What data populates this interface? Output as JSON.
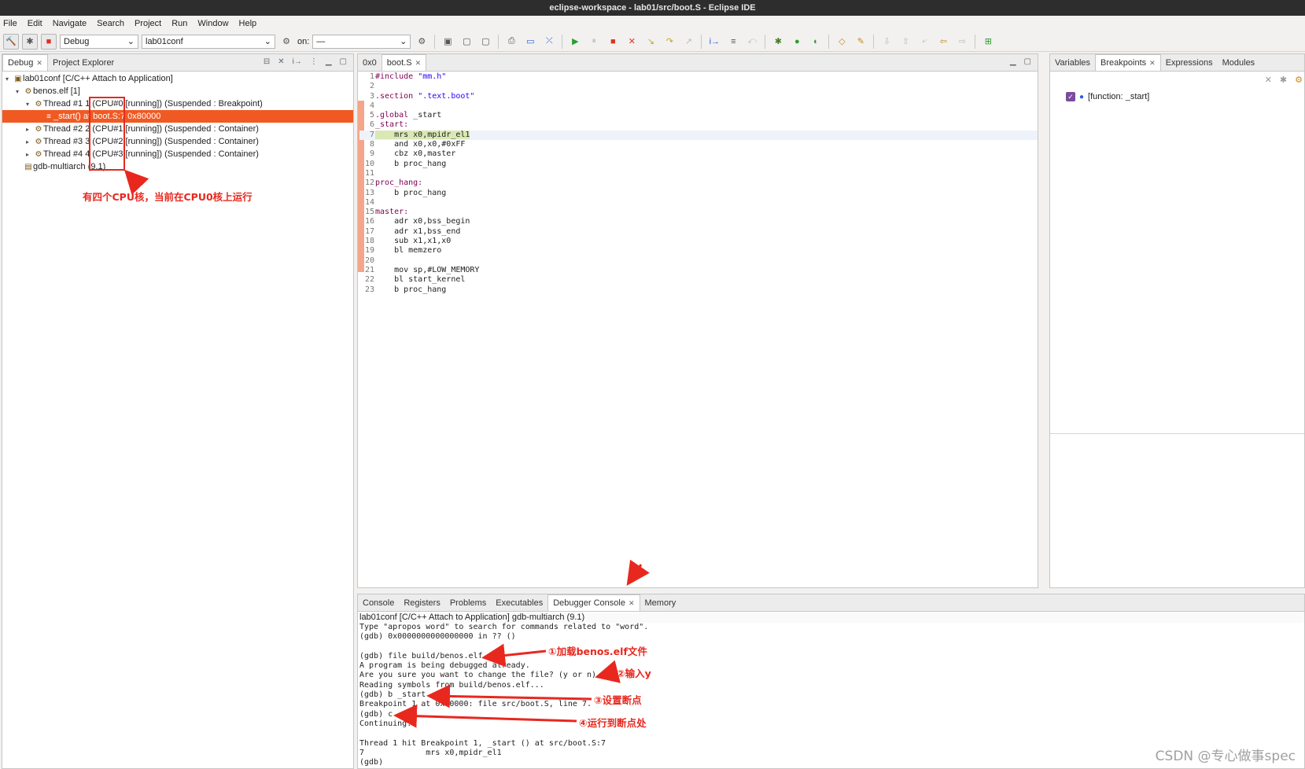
{
  "window": {
    "title": "eclipse-workspace - lab01/src/boot.S - Eclipse IDE"
  },
  "menu": [
    "File",
    "Edit",
    "Navigate",
    "Search",
    "Project",
    "Run",
    "Window",
    "Help"
  ],
  "toolbar": {
    "launch_mode": "Debug",
    "launch_config": "lab01conf",
    "target_label": "on:",
    "target_value": "—"
  },
  "debug_view": {
    "tabs": [
      {
        "label": "Debug",
        "active": true,
        "icon": "bug-icon"
      },
      {
        "label": "Project Explorer",
        "active": false,
        "icon": "folder-icon"
      }
    ],
    "tree": [
      {
        "level": 0,
        "twisty": "▾",
        "icon": "c-launch-icon",
        "label": "lab01conf [C/C++ Attach to Application]"
      },
      {
        "level": 1,
        "twisty": "▾",
        "icon": "process-icon",
        "label": "benos.elf [1]"
      },
      {
        "level": 2,
        "twisty": "▾",
        "icon": "thread-icon",
        "label": "Thread #1 1 (CPU#0 [running]) (Suspended : Breakpoint)"
      },
      {
        "level": 3,
        "twisty": "",
        "icon": "stack-frame-icon",
        "label": "_start() at boot.S:7 0x80000",
        "selected": true
      },
      {
        "level": 2,
        "twisty": "▸",
        "icon": "thread-icon",
        "label": "Thread #2 2 (CPU#1 [running]) (Suspended : Container)"
      },
      {
        "level": 2,
        "twisty": "▸",
        "icon": "thread-icon",
        "label": "Thread #3 3 (CPU#2 [running]) (Suspended : Container)"
      },
      {
        "level": 2,
        "twisty": "▸",
        "icon": "thread-icon",
        "label": "Thread #4 4 (CPU#3 [running]) (Suspended : Container)"
      },
      {
        "level": 1,
        "twisty": "",
        "icon": "gdb-icon",
        "label": "gdb-multiarch (9.1)"
      }
    ],
    "annotation": "有四个CPU核，当前在CPU0核上运行"
  },
  "editor": {
    "tabs": [
      {
        "label": "0x0",
        "active": false
      },
      {
        "label": "boot.S",
        "active": true
      }
    ],
    "lines": [
      {
        "n": "1",
        "html": "<span class='kw'>#include</span> <span class='str'>\"mm.h\"</span>"
      },
      {
        "n": "2",
        "html": ""
      },
      {
        "n": "3",
        "html": "<span class='kw'>.section</span> <span class='str'>\".text.boot\"</span>"
      },
      {
        "n": "4",
        "html": ""
      },
      {
        "n": "5",
        "html": "<span class='kw'>.global</span> _start"
      },
      {
        "n": "6",
        "html": "<span class='lab'>_start:</span>"
      },
      {
        "n": "7",
        "html": "    mrs x0,mpidr_el1",
        "current": true
      },
      {
        "n": "8",
        "html": "    and x0,x0,#0xFF"
      },
      {
        "n": "9",
        "html": "    cbz x0,master"
      },
      {
        "n": "10",
        "html": "    b proc_hang"
      },
      {
        "n": "11",
        "html": ""
      },
      {
        "n": "12",
        "html": "<span class='lab'>proc_hang:</span>"
      },
      {
        "n": "13",
        "html": "    b proc_hang"
      },
      {
        "n": "14",
        "html": ""
      },
      {
        "n": "15",
        "html": "<span class='lab'>master:</span>"
      },
      {
        "n": "16",
        "html": "    adr x0,bss_begin"
      },
      {
        "n": "17",
        "html": "    adr x1,bss_end"
      },
      {
        "n": "18",
        "html": "    sub x1,x1,x0"
      },
      {
        "n": "19",
        "html": "    bl memzero"
      },
      {
        "n": "20",
        "html": ""
      },
      {
        "n": "21",
        "html": "    mov sp,#LOW_MEMORY"
      },
      {
        "n": "22",
        "html": "    bl start_kernel"
      },
      {
        "n": "23",
        "html": "    b proc_hang"
      }
    ]
  },
  "right_view": {
    "tabs": [
      {
        "label": "Variables",
        "active": false
      },
      {
        "label": "Breakpoints",
        "active": true
      },
      {
        "label": "Expressions",
        "active": false
      },
      {
        "label": "Modules",
        "active": false
      }
    ],
    "breakpoint": {
      "label": "[function: _start]",
      "checked": true
    }
  },
  "console_view": {
    "tabs": [
      {
        "label": "Console",
        "active": false
      },
      {
        "label": "Registers",
        "active": false
      },
      {
        "label": "Problems",
        "active": false
      },
      {
        "label": "Executables",
        "active": false
      },
      {
        "label": "Debugger Console",
        "active": true
      },
      {
        "label": "Memory",
        "active": false
      }
    ],
    "header": "lab01conf [C/C++ Attach to Application] gdb-multiarch (9.1)",
    "lines": [
      "Type \"apropos word\" to search for commands related to \"word\".",
      "(gdb) 0x0000000000000000 in ?? ()",
      "",
      "(gdb) file build/benos.elf",
      "A program is being debugged already.",
      "Are you sure you want to change the file? (y or n) y",
      "Reading symbols from build/benos.elf...",
      "(gdb) b _start",
      "Breakpoint 1 at 0x80000: file src/boot.S, line 7.",
      "(gdb) c",
      "Continuing.",
      "",
      "Thread 1 hit Breakpoint 1, _start () at src/boot.S:7",
      "7             mrs x0,mpidr_el1",
      "(gdb)"
    ],
    "annotations": [
      "①加载benos.elf文件",
      "②输入y",
      "③设置断点",
      "④运行到断点处"
    ]
  },
  "watermark": "CSDN @专心做事spec",
  "colors": {
    "selection": "#f05a22",
    "annotation": "#e8281f",
    "current_line": "#d9e8b4"
  }
}
